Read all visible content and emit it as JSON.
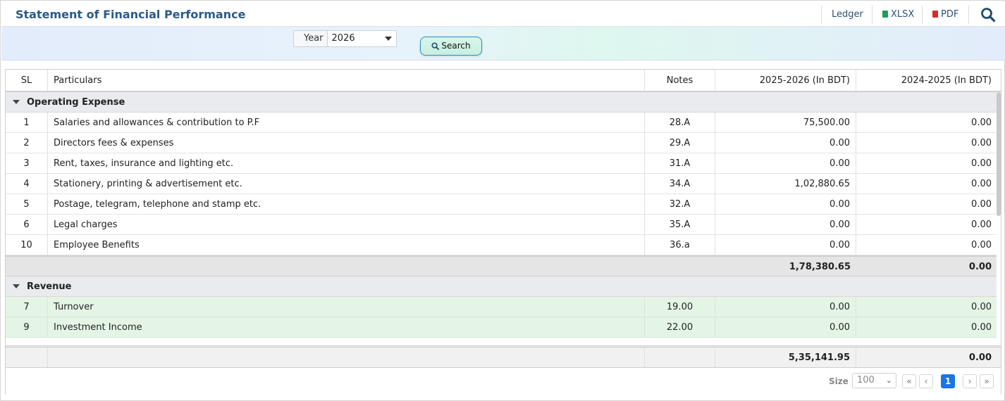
{
  "header": {
    "title": "Statement of Financial Performance",
    "ledger_label": "Ledger",
    "xlsx_label": "XLSX",
    "pdf_label": "PDF"
  },
  "filters": {
    "year_label": "Year",
    "year_value": "2026",
    "search_label": "Search"
  },
  "table": {
    "columns": [
      "SL",
      "Particulars",
      "Notes",
      "2025-2026 (In BDT)",
      "2024-2025 (In BDT)"
    ],
    "groups": [
      {
        "name": "Operating Expense",
        "rows": [
          {
            "sl": "1",
            "particulars": "Salaries and allowances & contribution to P.F",
            "notes": "28.A",
            "y1": "75,500.00",
            "y2": "0.00"
          },
          {
            "sl": "2",
            "particulars": "Directors fees & expenses",
            "notes": "29.A",
            "y1": "0.00",
            "y2": "0.00"
          },
          {
            "sl": "3",
            "particulars": "Rent, taxes, insurance and lighting etc.",
            "notes": "31.A",
            "y1": "0.00",
            "y2": "0.00"
          },
          {
            "sl": "4",
            "particulars": "Stationery, printing & advertisement etc.",
            "notes": "34.A",
            "y1": "1,02,880.65",
            "y2": "0.00"
          },
          {
            "sl": "5",
            "particulars": "Postage, telegram, telephone and stamp etc.",
            "notes": "32.A",
            "y1": "0.00",
            "y2": "0.00"
          },
          {
            "sl": "6",
            "particulars": "Legal charges",
            "notes": "35.A",
            "y1": "0.00",
            "y2": "0.00"
          },
          {
            "sl": "10",
            "particulars": "Employee Benefits",
            "notes": "36.a",
            "y1": "0.00",
            "y2": "0.00"
          }
        ],
        "total_y1": "1,78,380.65",
        "total_y2": "0.00"
      },
      {
        "name": "Revenue",
        "rows": [
          {
            "sl": "7",
            "particulars": "Turnover",
            "notes": "19.00",
            "y1": "0.00",
            "y2": "0.00"
          },
          {
            "sl": "9",
            "particulars": "Investment Income",
            "notes": "22.00",
            "y1": "0.00",
            "y2": "0.00"
          }
        ]
      }
    ],
    "grand_total_y1": "5,35,141.95",
    "grand_total_y2": "0.00"
  },
  "pager": {
    "size_label": "Size",
    "size_value": "100",
    "first": "«",
    "prev": "‹",
    "current_page": "1",
    "next": "›",
    "last": "»"
  }
}
